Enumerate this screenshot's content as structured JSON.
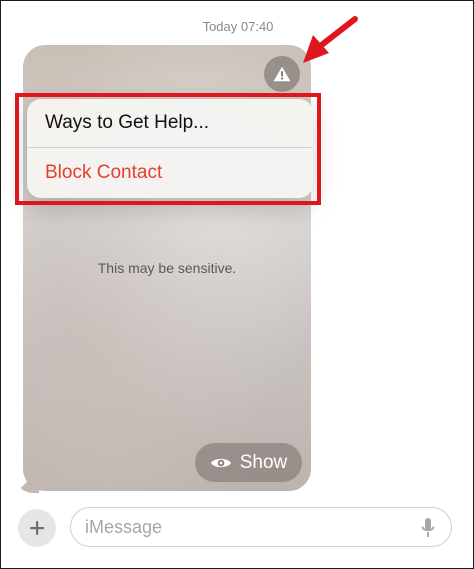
{
  "timestamp": "Today 07:40",
  "bubble": {
    "sensitive_text": "This may be sensitive.",
    "show_label": "Show",
    "warning_icon": "exclamation-triangle-icon",
    "show_icon": "eye-icon"
  },
  "menu": {
    "items": [
      {
        "label": "Ways to Get Help...",
        "color": "#111111"
      },
      {
        "label": "Block Contact",
        "color": "#e5402e"
      }
    ]
  },
  "annotation": {
    "highlight_color": "#e0161f",
    "arrow_color": "#e0161f"
  },
  "composer": {
    "placeholder": "iMessage",
    "plus_icon": "plus-icon",
    "mic_icon": "microphone-icon"
  }
}
